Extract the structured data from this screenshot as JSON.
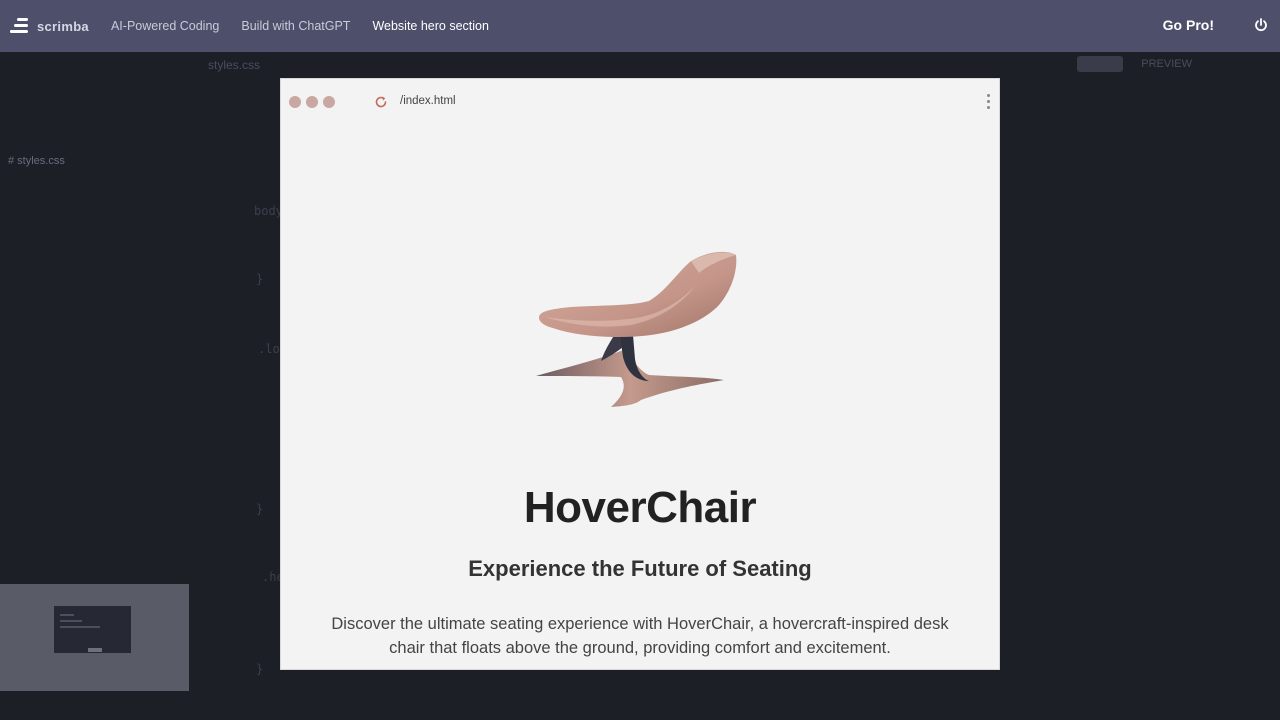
{
  "topbar": {
    "logo_text": "scrimba",
    "breadcrumbs": [
      {
        "label": "AI-Powered Coding"
      },
      {
        "label": "Build with ChatGPT"
      },
      {
        "label": "Website hero section"
      }
    ],
    "go_pro": "Go Pro!",
    "bg_color": "#4d4f6b"
  },
  "editor": {
    "file_tree": [
      "",
      "",
      "",
      "",
      "# styles.css",
      ""
    ],
    "active_tab": "styles.css",
    "right_tabs": [
      "",
      "PREVIEW",
      ""
    ],
    "code_lines": [
      "body",
      "}",
      ".lo",
      "}",
      ".he",
      "}"
    ]
  },
  "preview": {
    "url": "/index.html",
    "title": "HoverChair",
    "subtitle": "Experience the Future of Seating",
    "description": "Discover the ultimate seating experience with HoverChair, a hovercraft-inspired desk chair that floats above the ground, providing comfort and excitement.",
    "dot_color": "#c9a7a3",
    "bg_color": "#f3f3f3"
  },
  "icons": {
    "power": "power-icon",
    "reload": "reload-icon",
    "menu": "kebab-icon"
  }
}
